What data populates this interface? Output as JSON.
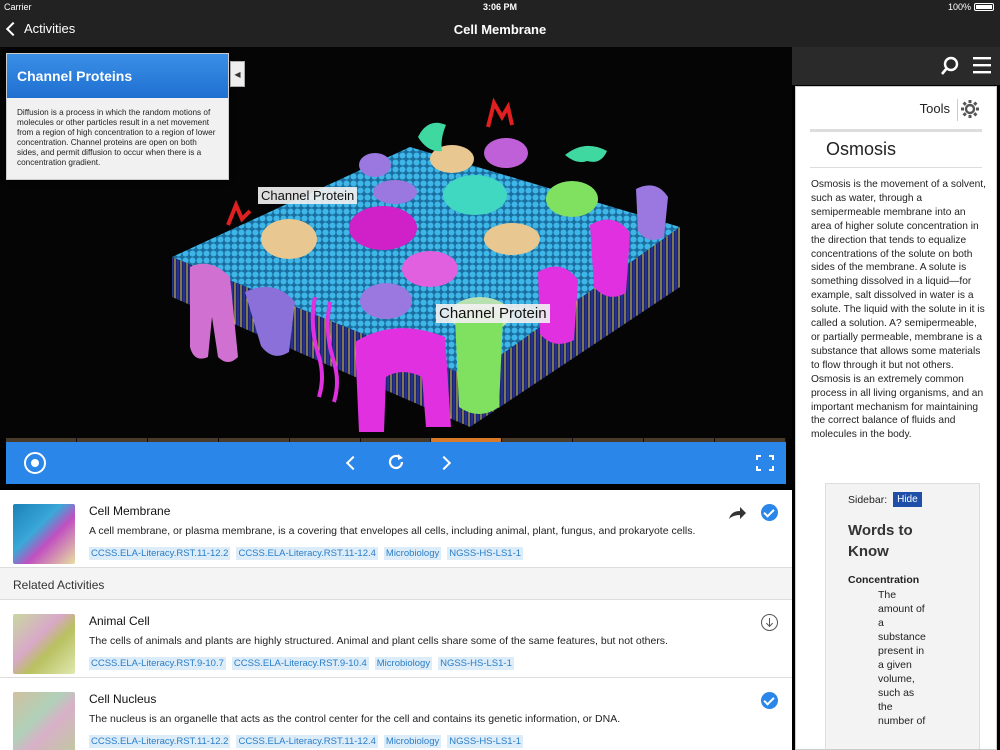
{
  "status": {
    "carrier": "Carrier",
    "time": "3:06 PM",
    "battery": "100%"
  },
  "nav": {
    "back_label": "Activities",
    "title": "Cell Membrane"
  },
  "viewer": {
    "panel_title": "Channel Proteins",
    "panel_text": "Diffusion is a process in which the random motions of molecules or other particles result in a net movement from a region of high concentration to a region of lower concentration. Channel proteins are open on both sides, and permit diffusion to occur when there is a concentration gradient.",
    "label1": "Channel Protein",
    "label2": "Channel Protein",
    "timeline_segments": 11,
    "timeline_active_index": 6
  },
  "current": {
    "title": "Cell Membrane",
    "description": "A cell membrane, or plasma membrane, is a covering that envelopes all cells, including animal, plant, fungus, and prokaryote cells.",
    "tags": [
      "CCSS.ELA-Literacy.RST.11-12.2",
      "CCSS.ELA-Literacy.RST.11-12.4",
      "Microbiology",
      "NGSS-HS-LS1-1"
    ]
  },
  "related": {
    "heading": "Related Activities",
    "items": [
      {
        "title": "Animal Cell",
        "description": "The cells of animals and plants are highly structured. Animal and plant cells share some of the same features, but not others.",
        "tags": [
          "CCSS.ELA-Literacy.RST.9-10.7",
          "CCSS.ELA-Literacy.RST.9-10.4",
          "Microbiology",
          "NGSS-HS-LS1-1"
        ]
      },
      {
        "title": "Cell Nucleus",
        "description": "The nucleus is an organelle that acts as the control center for the cell and contains its genetic information, or DNA.",
        "tags": [
          "CCSS.ELA-Literacy.RST.11-12.2",
          "CCSS.ELA-Literacy.RST.11-12.4",
          "Microbiology",
          "NGSS-HS-LS1-1"
        ]
      }
    ]
  },
  "right_panel": {
    "tools_label": "Tools",
    "title": "Osmosis",
    "body": "Osmosis is the movement of a solvent, such as water, through a semipermeable membrane into an area of higher solute concentration in the direction that tends to equalize concentrations of the solute on both sides of the membrane. A solute is something dissolved in a liquid—for example, salt dissolved in water is a solute. The liquid with the solute in it is called a solution. A? semipermeable, or partially permeable, membrane is a substance that allows some materials to flow through it but not others. Osmosis is an extremely common process in all living organisms, and an important mechanism for maintaining the correct balance of fluids and molecules in the body.",
    "sidebar_label": "Sidebar:",
    "hide_label": "Hide",
    "words_title": "Words to Know",
    "term": "Concentration",
    "definition": "The amount of a substance present in a given volume, such as the number of"
  },
  "colors": {
    "accent": "#2a86e8",
    "tag_bg": "#dcecf8",
    "tag_text": "#2a7ec8",
    "nav_bg": "#222222"
  }
}
